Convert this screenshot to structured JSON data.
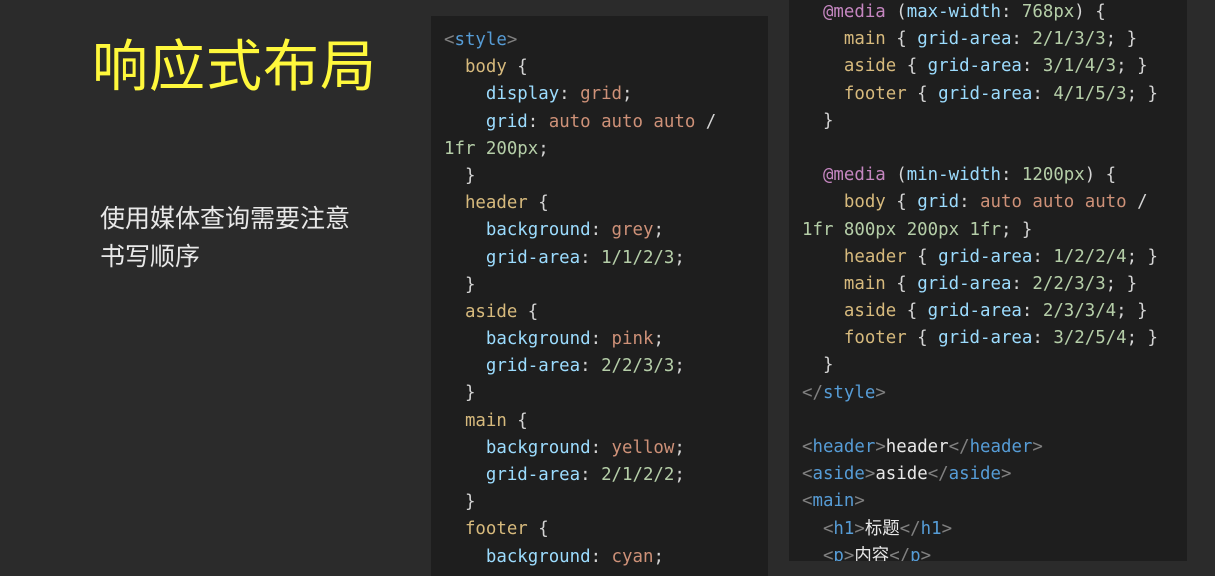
{
  "slide": {
    "title": "响应式布局",
    "subtitle": "使用媒体查询需要注意书写顺序"
  },
  "code_left": [
    [
      [
        "tp",
        "<"
      ],
      [
        "tag",
        "style"
      ],
      [
        "tp",
        ">"
      ]
    ],
    [
      [
        "sel",
        "  body"
      ],
      [
        "p",
        " {"
      ]
    ],
    [
      [
        "prop",
        "    display"
      ],
      [
        "p",
        ": "
      ],
      [
        "val",
        "grid"
      ],
      [
        "p",
        ";"
      ]
    ],
    [
      [
        "prop",
        "    grid"
      ],
      [
        "p",
        ": "
      ],
      [
        "val",
        "auto auto auto"
      ],
      [
        "p",
        " /"
      ]
    ],
    [
      [
        "num",
        "1fr 200px"
      ],
      [
        "p",
        ";"
      ]
    ],
    [
      [
        "p",
        "  }"
      ]
    ],
    [
      [
        "sel",
        "  header"
      ],
      [
        "p",
        " {"
      ]
    ],
    [
      [
        "prop",
        "    background"
      ],
      [
        "p",
        ": "
      ],
      [
        "val",
        "grey"
      ],
      [
        "p",
        ";"
      ]
    ],
    [
      [
        "prop",
        "    grid-area"
      ],
      [
        "p",
        ": "
      ],
      [
        "num",
        "1/1/2/3"
      ],
      [
        "p",
        ";"
      ]
    ],
    [
      [
        "p",
        "  }"
      ]
    ],
    [
      [
        "sel",
        "  aside"
      ],
      [
        "p",
        " {"
      ]
    ],
    [
      [
        "prop",
        "    background"
      ],
      [
        "p",
        ": "
      ],
      [
        "val",
        "pink"
      ],
      [
        "p",
        ";"
      ]
    ],
    [
      [
        "prop",
        "    grid-area"
      ],
      [
        "p",
        ": "
      ],
      [
        "num",
        "2/2/3/3"
      ],
      [
        "p",
        ";"
      ]
    ],
    [
      [
        "p",
        "  }"
      ]
    ],
    [
      [
        "sel",
        "  main"
      ],
      [
        "p",
        " {"
      ]
    ],
    [
      [
        "prop",
        "    background"
      ],
      [
        "p",
        ": "
      ],
      [
        "val",
        "yellow"
      ],
      [
        "p",
        ";"
      ]
    ],
    [
      [
        "prop",
        "    grid-area"
      ],
      [
        "p",
        ": "
      ],
      [
        "num",
        "2/1/2/2"
      ],
      [
        "p",
        ";"
      ]
    ],
    [
      [
        "p",
        "  }"
      ]
    ],
    [
      [
        "sel",
        "  footer"
      ],
      [
        "p",
        " {"
      ]
    ],
    [
      [
        "prop",
        "    background"
      ],
      [
        "p",
        ": "
      ],
      [
        "val",
        "cyan"
      ],
      [
        "p",
        ";"
      ]
    ]
  ],
  "code_right": [
    [
      [
        "kw",
        "  @media"
      ],
      [
        "p",
        " ("
      ],
      [
        "prop",
        "max-width"
      ],
      [
        "p",
        ": "
      ],
      [
        "num",
        "768px"
      ],
      [
        "p",
        ") {"
      ]
    ],
    [
      [
        "sel",
        "    main"
      ],
      [
        "p",
        " { "
      ],
      [
        "prop",
        "grid-area"
      ],
      [
        "p",
        ": "
      ],
      [
        "num",
        "2/1/3/3"
      ],
      [
        "p",
        "; }"
      ]
    ],
    [
      [
        "sel",
        "    aside"
      ],
      [
        "p",
        " { "
      ],
      [
        "prop",
        "grid-area"
      ],
      [
        "p",
        ": "
      ],
      [
        "num",
        "3/1/4/3"
      ],
      [
        "p",
        "; }"
      ]
    ],
    [
      [
        "sel",
        "    footer"
      ],
      [
        "p",
        " { "
      ],
      [
        "prop",
        "grid-area"
      ],
      [
        "p",
        ": "
      ],
      [
        "num",
        "4/1/5/3"
      ],
      [
        "p",
        "; }"
      ]
    ],
    [
      [
        "p",
        "  }"
      ]
    ],
    [
      [
        "p",
        " "
      ]
    ],
    [
      [
        "kw",
        "  @media"
      ],
      [
        "p",
        " ("
      ],
      [
        "prop",
        "min-width"
      ],
      [
        "p",
        ": "
      ],
      [
        "num",
        "1200px"
      ],
      [
        "p",
        ") {"
      ]
    ],
    [
      [
        "sel",
        "    body"
      ],
      [
        "p",
        " { "
      ],
      [
        "prop",
        "grid"
      ],
      [
        "p",
        ": "
      ],
      [
        "val",
        "auto auto auto"
      ],
      [
        "p",
        " /"
      ]
    ],
    [
      [
        "num",
        "1fr 800px 200px 1fr"
      ],
      [
        "p",
        "; }"
      ]
    ],
    [
      [
        "sel",
        "    header"
      ],
      [
        "p",
        " { "
      ],
      [
        "prop",
        "grid-area"
      ],
      [
        "p",
        ": "
      ],
      [
        "num",
        "1/2/2/4"
      ],
      [
        "p",
        "; }"
      ]
    ],
    [
      [
        "sel",
        "    main"
      ],
      [
        "p",
        " { "
      ],
      [
        "prop",
        "grid-area"
      ],
      [
        "p",
        ": "
      ],
      [
        "num",
        "2/2/3/3"
      ],
      [
        "p",
        "; }"
      ]
    ],
    [
      [
        "sel",
        "    aside"
      ],
      [
        "p",
        " { "
      ],
      [
        "prop",
        "grid-area"
      ],
      [
        "p",
        ": "
      ],
      [
        "num",
        "2/3/3/4"
      ],
      [
        "p",
        "; }"
      ]
    ],
    [
      [
        "sel",
        "    footer"
      ],
      [
        "p",
        " { "
      ],
      [
        "prop",
        "grid-area"
      ],
      [
        "p",
        ": "
      ],
      [
        "num",
        "3/2/5/4"
      ],
      [
        "p",
        "; }"
      ]
    ],
    [
      [
        "p",
        "  }"
      ]
    ],
    [
      [
        "tp",
        "</"
      ],
      [
        "tag",
        "style"
      ],
      [
        "tp",
        ">"
      ]
    ],
    [
      [
        "p",
        " "
      ]
    ],
    [
      [
        "tp",
        "<"
      ],
      [
        "tag",
        "header"
      ],
      [
        "tp",
        ">"
      ],
      [
        "txt",
        "header"
      ],
      [
        "tp",
        "</"
      ],
      [
        "tag",
        "header"
      ],
      [
        "tp",
        ">"
      ]
    ],
    [
      [
        "tp",
        "<"
      ],
      [
        "tag",
        "aside"
      ],
      [
        "tp",
        ">"
      ],
      [
        "txt",
        "aside"
      ],
      [
        "tp",
        "</"
      ],
      [
        "tag",
        "aside"
      ],
      [
        "tp",
        ">"
      ]
    ],
    [
      [
        "tp",
        "<"
      ],
      [
        "tag",
        "main"
      ],
      [
        "tp",
        ">"
      ]
    ],
    [
      [
        "tp",
        "  <"
      ],
      [
        "tag",
        "h1"
      ],
      [
        "tp",
        ">"
      ],
      [
        "txt",
        "标题"
      ],
      [
        "tp",
        "</"
      ],
      [
        "tag",
        "h1"
      ],
      [
        "tp",
        ">"
      ]
    ],
    [
      [
        "tp",
        "  <"
      ],
      [
        "tag",
        "p"
      ],
      [
        "tp",
        ">"
      ],
      [
        "txt",
        "内容"
      ],
      [
        "tp",
        "</"
      ],
      [
        "tag",
        "p"
      ],
      [
        "tp",
        ">"
      ]
    ]
  ]
}
